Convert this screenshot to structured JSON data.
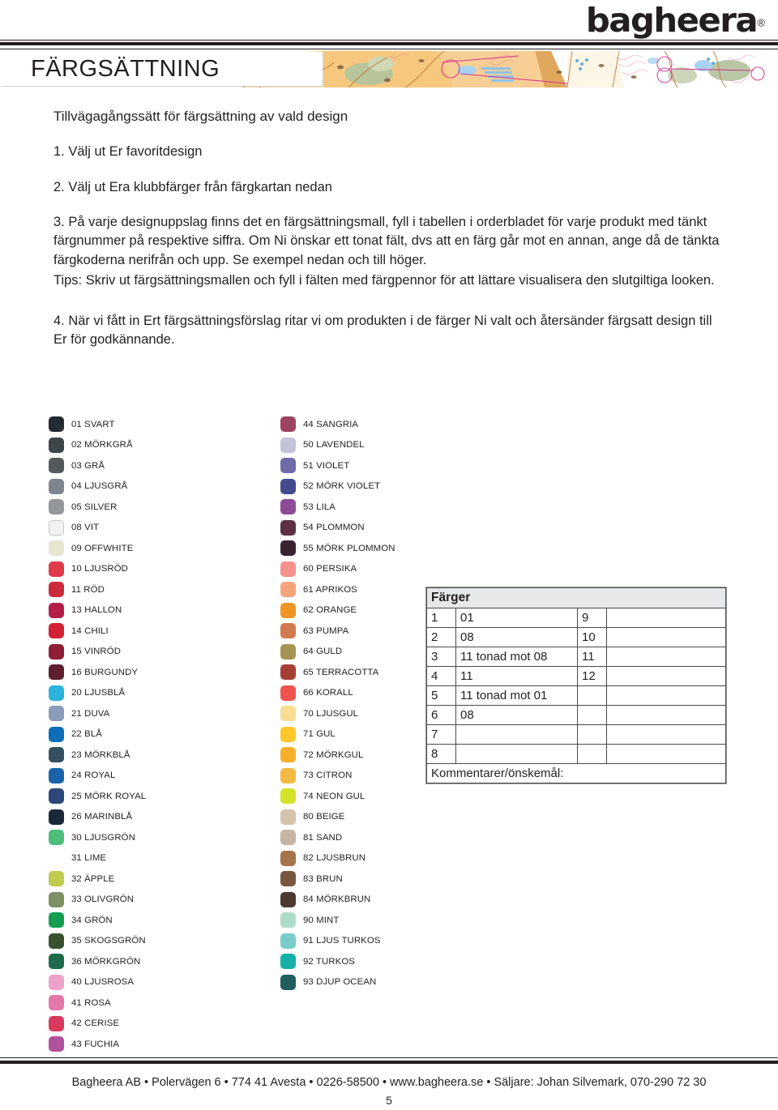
{
  "header": {
    "logo_text": "bagheera",
    "logo_registered": "®",
    "banner_title": "FÄRGSÄTTNING"
  },
  "instructions": {
    "heading": "Tillvägagångssätt för färgsättning av vald design",
    "item1": "1. Välj ut Er favoritdesign",
    "item2": "2. Välj ut Era klubbfärger från färgkartan nedan",
    "item3": "3. På varje designuppslag finns det en färgsättningsmall, fyll i tabellen i orderbladet för varje produkt med tänkt färgnummer på respektive siffra. Om Ni önskar ett tonat fält, dvs att en färg går mot en annan, ange då de tänkta färgkoderna nerifrån och upp. Se exempel nedan och till höger.",
    "item3_tips": "Tips: Skriv ut färgsättningsmallen och fyll i fälten med färgpennor för att lättare visualisera den slutgiltiga looken.",
    "item4": "4. När vi fått in Ert färgsättningsförslag ritar vi om produkten i de färger Ni valt och återsänder färgsatt design till Er för godkännande."
  },
  "colors_left": [
    {
      "label": "01 SVART",
      "hex": "#232b33"
    },
    {
      "label": "02 MÖRKGRÅ",
      "hex": "#3d474a"
    },
    {
      "label": "03 GRÅ",
      "hex": "#54595c"
    },
    {
      "label": "04 LJUSGRÅ",
      "hex": "#7d868e"
    },
    {
      "label": "05 SILVER",
      "hex": "#93979a"
    },
    {
      "label": "08 VIT",
      "hex": "#f2f2f3",
      "outlined": true
    },
    {
      "label": "09 OFFWHITE",
      "hex": "#e7e4cf"
    },
    {
      "label": "10 LJUSRÖD",
      "hex": "#e03a4b"
    },
    {
      "label": "11 RÖD",
      "hex": "#cb2b3c"
    },
    {
      "label": "13 HALLON",
      "hex": "#b51d49"
    },
    {
      "label": "14 CHILI",
      "hex": "#d32034"
    },
    {
      "label": "15 VINRÖD",
      "hex": "#8d2036"
    },
    {
      "label": "16 BURGUNDY",
      "hex": "#5b1f2e"
    },
    {
      "label": "20 LJUSBLÅ",
      "hex": "#2bb2dd"
    },
    {
      "label": "21 DUVA",
      "hex": "#8b9cba"
    },
    {
      "label": "22 BLÅ",
      "hex": "#0d6fb8"
    },
    {
      "label": "23 MÖRKBLÅ",
      "hex": "#34505f"
    },
    {
      "label": "24 ROYAL",
      "hex": "#1963ab"
    },
    {
      "label": "25 MÖRK ROYAL",
      "hex": "#2c4678"
    },
    {
      "label": "26 MARINBLÅ",
      "hex": "#1b2838"
    },
    {
      "label": "30 LJUSGRÖN",
      "hex": "#4dbd7c"
    },
    {
      "label": "31 LIME",
      "hex": "#86b койны"
    },
    {
      "label": "32 ÄPPLE",
      "hex": "#c0cb4f"
    },
    {
      "label": "33 OLIVGRÖN",
      "hex": "#7d9064"
    },
    {
      "label": "34 GRÖN",
      "hex": "#159e4f"
    },
    {
      "label": "35 SKOGSGRÖN",
      "hex": "#39512f"
    },
    {
      "label": "36 MÖRKGRÖN",
      "hex": "#1d6b4a"
    },
    {
      "label": "40 LJUSROSA",
      "hex": "#eda3c9"
    },
    {
      "label": "41 ROSA",
      "hex": "#e377a9"
    },
    {
      "label": "42 CERISE",
      "hex": "#d9395e"
    },
    {
      "label": "43 FUCHIA",
      "hex": "#b2519c"
    }
  ],
  "colors_right": [
    {
      "label": "44 SANGRIA",
      "hex": "#9e4462"
    },
    {
      "label": "50 LAVENDEL",
      "hex": "#c3c3d8"
    },
    {
      "label": "51 VIOLET",
      "hex": "#6f6aa8"
    },
    {
      "label": "52 MÖRK VIOLET",
      "hex": "#434a8d"
    },
    {
      "label": "53 LILA",
      "hex": "#8e4a96"
    },
    {
      "label": "54 PLOMMON",
      "hex": "#5c2f45"
    },
    {
      "label": "55 MÖRK PLOMMON",
      "hex": "#3a2331"
    },
    {
      "label": "60 PERSIKA",
      "hex": "#f3928d"
    },
    {
      "label": "61 APRIKOS",
      "hex": "#f4a57c"
    },
    {
      "label": "62 ORANGE",
      "hex": "#ee9526"
    },
    {
      "label": "63 PUMPA",
      "hex": "#d3794f"
    },
    {
      "label": "64 GULD",
      "hex": "#a69552"
    },
    {
      "label": "65 TERRACOTTA",
      "hex": "#a53f35"
    },
    {
      "label": "66 KORALL",
      "hex": "#f0544f"
    },
    {
      "label": "70 LJUSGUL",
      "hex": "#f9dd93"
    },
    {
      "label": "71 GUL",
      "hex": "#fcc82c"
    },
    {
      "label": "72 MÖRKGUL",
      "hex": "#f8b02c"
    },
    {
      "label": "73 CITRON",
      "hex": "#f3ba43"
    },
    {
      "label": "74 NEON GUL",
      "hex": "#d5e229"
    },
    {
      "label": "80 BEIGE",
      "hex": "#d6c3ad"
    },
    {
      "label": "81 SAND",
      "hex": "#c6b4a4"
    },
    {
      "label": "82 LJUSBRUN",
      "hex": "#a5744a"
    },
    {
      "label": "83 BRUN",
      "hex": "#79573f"
    },
    {
      "label": "84 MÖRKBRUN",
      "hex": "#4c3a30"
    },
    {
      "label": "90 MINT",
      "hex": "#aedcc9"
    },
    {
      "label": "91 LJUS TURKOS",
      "hex": "#78cdcb"
    },
    {
      "label": "92 TURKOS",
      "hex": "#16b0aa"
    },
    {
      "label": "93 DJUP OCEAN",
      "hex": "#1f5e5e"
    }
  ],
  "farger_table": {
    "title": "Färger",
    "rows": [
      {
        "n1": "1",
        "v1": "01",
        "n2": "9",
        "v2": ""
      },
      {
        "n1": "2",
        "v1": "08",
        "n2": "10",
        "v2": ""
      },
      {
        "n1": "3",
        "v1": "11 tonad mot 08",
        "n2": "11",
        "v2": ""
      },
      {
        "n1": "4",
        "v1": "11",
        "n2": "12",
        "v2": ""
      },
      {
        "n1": "5",
        "v1": "11 tonad mot 01",
        "n2": "",
        "v2": ""
      },
      {
        "n1": "6",
        "v1": "08",
        "n2": "",
        "v2": ""
      },
      {
        "n1": "7",
        "v1": "",
        "n2": "",
        "v2": ""
      },
      {
        "n1": "8",
        "v1": "",
        "n2": "",
        "v2": ""
      }
    ],
    "comment_label": "Kommentarer/önskemål:"
  },
  "footer": {
    "text": "Bagheera AB • Polervägen 6 • 774 41 Avesta • 0226-58500 • www.bagheera.se • Säljare: Johan Silvemark, 070-290 72 30",
    "page_number": "5"
  }
}
